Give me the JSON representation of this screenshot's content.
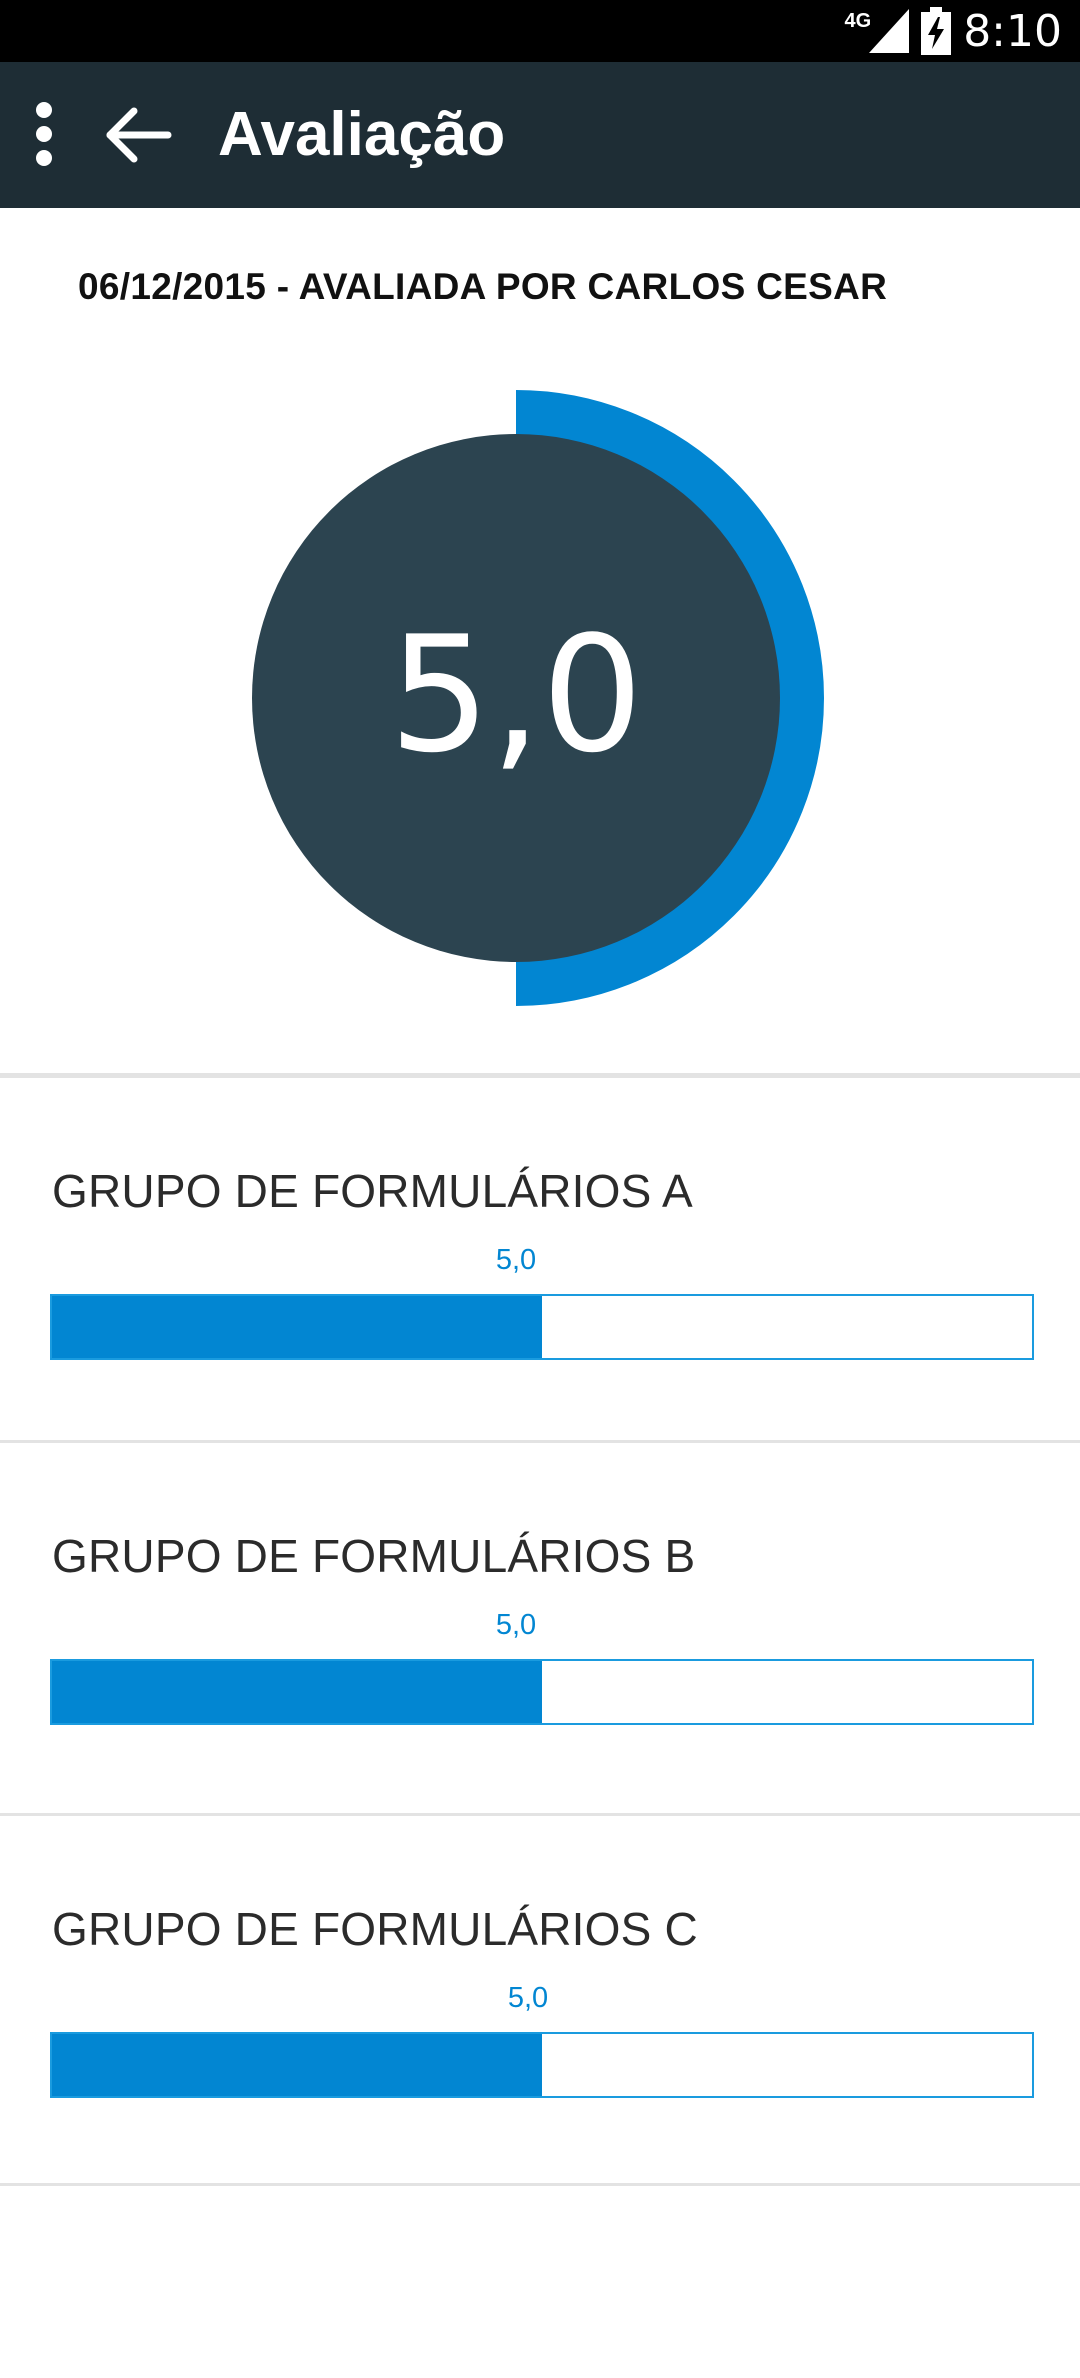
{
  "status_bar": {
    "network": "4G",
    "time": "8:10"
  },
  "app_bar": {
    "title": "Avaliação"
  },
  "header": {
    "date_line": "06/12/2015 - AVALIADA POR CARLOS CESAR"
  },
  "score": {
    "value": "5,0",
    "fraction": 0.5
  },
  "colors": {
    "accent": "#0286d2",
    "dark": "#2c4450",
    "toolbar": "#1e2d35"
  },
  "groups": [
    {
      "title": "GRUPO DE FORMULÁRIOS A",
      "value": "5,0",
      "fraction": 0.5
    },
    {
      "title": "GRUPO DE FORMULÁRIOS B",
      "value": "5,0",
      "fraction": 0.5
    },
    {
      "title": "GRUPO DE FORMULÁRIOS C",
      "value": "5,0",
      "fraction": 0.5
    }
  ]
}
